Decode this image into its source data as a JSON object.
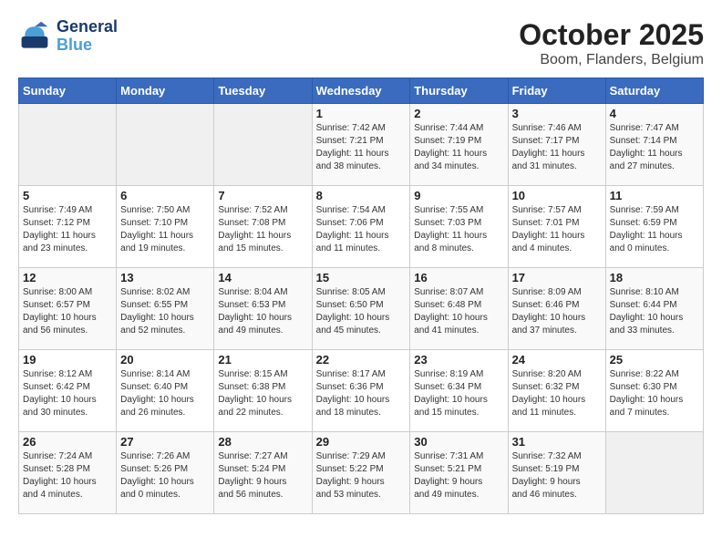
{
  "header": {
    "logo_line1": "General",
    "logo_line2": "Blue",
    "title": "October 2025",
    "subtitle": "Boom, Flanders, Belgium"
  },
  "days_of_week": [
    "Sunday",
    "Monday",
    "Tuesday",
    "Wednesday",
    "Thursday",
    "Friday",
    "Saturday"
  ],
  "weeks": [
    [
      {
        "day": "",
        "info": ""
      },
      {
        "day": "",
        "info": ""
      },
      {
        "day": "",
        "info": ""
      },
      {
        "day": "1",
        "info": "Sunrise: 7:42 AM\nSunset: 7:21 PM\nDaylight: 11 hours\nand 38 minutes."
      },
      {
        "day": "2",
        "info": "Sunrise: 7:44 AM\nSunset: 7:19 PM\nDaylight: 11 hours\nand 34 minutes."
      },
      {
        "day": "3",
        "info": "Sunrise: 7:46 AM\nSunset: 7:17 PM\nDaylight: 11 hours\nand 31 minutes."
      },
      {
        "day": "4",
        "info": "Sunrise: 7:47 AM\nSunset: 7:14 PM\nDaylight: 11 hours\nand 27 minutes."
      }
    ],
    [
      {
        "day": "5",
        "info": "Sunrise: 7:49 AM\nSunset: 7:12 PM\nDaylight: 11 hours\nand 23 minutes."
      },
      {
        "day": "6",
        "info": "Sunrise: 7:50 AM\nSunset: 7:10 PM\nDaylight: 11 hours\nand 19 minutes."
      },
      {
        "day": "7",
        "info": "Sunrise: 7:52 AM\nSunset: 7:08 PM\nDaylight: 11 hours\nand 15 minutes."
      },
      {
        "day": "8",
        "info": "Sunrise: 7:54 AM\nSunset: 7:06 PM\nDaylight: 11 hours\nand 11 minutes."
      },
      {
        "day": "9",
        "info": "Sunrise: 7:55 AM\nSunset: 7:03 PM\nDaylight: 11 hours\nand 8 minutes."
      },
      {
        "day": "10",
        "info": "Sunrise: 7:57 AM\nSunset: 7:01 PM\nDaylight: 11 hours\nand 4 minutes."
      },
      {
        "day": "11",
        "info": "Sunrise: 7:59 AM\nSunset: 6:59 PM\nDaylight: 11 hours\nand 0 minutes."
      }
    ],
    [
      {
        "day": "12",
        "info": "Sunrise: 8:00 AM\nSunset: 6:57 PM\nDaylight: 10 hours\nand 56 minutes."
      },
      {
        "day": "13",
        "info": "Sunrise: 8:02 AM\nSunset: 6:55 PM\nDaylight: 10 hours\nand 52 minutes."
      },
      {
        "day": "14",
        "info": "Sunrise: 8:04 AM\nSunset: 6:53 PM\nDaylight: 10 hours\nand 49 minutes."
      },
      {
        "day": "15",
        "info": "Sunrise: 8:05 AM\nSunset: 6:50 PM\nDaylight: 10 hours\nand 45 minutes."
      },
      {
        "day": "16",
        "info": "Sunrise: 8:07 AM\nSunset: 6:48 PM\nDaylight: 10 hours\nand 41 minutes."
      },
      {
        "day": "17",
        "info": "Sunrise: 8:09 AM\nSunset: 6:46 PM\nDaylight: 10 hours\nand 37 minutes."
      },
      {
        "day": "18",
        "info": "Sunrise: 8:10 AM\nSunset: 6:44 PM\nDaylight: 10 hours\nand 33 minutes."
      }
    ],
    [
      {
        "day": "19",
        "info": "Sunrise: 8:12 AM\nSunset: 6:42 PM\nDaylight: 10 hours\nand 30 minutes."
      },
      {
        "day": "20",
        "info": "Sunrise: 8:14 AM\nSunset: 6:40 PM\nDaylight: 10 hours\nand 26 minutes."
      },
      {
        "day": "21",
        "info": "Sunrise: 8:15 AM\nSunset: 6:38 PM\nDaylight: 10 hours\nand 22 minutes."
      },
      {
        "day": "22",
        "info": "Sunrise: 8:17 AM\nSunset: 6:36 PM\nDaylight: 10 hours\nand 18 minutes."
      },
      {
        "day": "23",
        "info": "Sunrise: 8:19 AM\nSunset: 6:34 PM\nDaylight: 10 hours\nand 15 minutes."
      },
      {
        "day": "24",
        "info": "Sunrise: 8:20 AM\nSunset: 6:32 PM\nDaylight: 10 hours\nand 11 minutes."
      },
      {
        "day": "25",
        "info": "Sunrise: 8:22 AM\nSunset: 6:30 PM\nDaylight: 10 hours\nand 7 minutes."
      }
    ],
    [
      {
        "day": "26",
        "info": "Sunrise: 7:24 AM\nSunset: 5:28 PM\nDaylight: 10 hours\nand 4 minutes."
      },
      {
        "day": "27",
        "info": "Sunrise: 7:26 AM\nSunset: 5:26 PM\nDaylight: 10 hours\nand 0 minutes."
      },
      {
        "day": "28",
        "info": "Sunrise: 7:27 AM\nSunset: 5:24 PM\nDaylight: 9 hours\nand 56 minutes."
      },
      {
        "day": "29",
        "info": "Sunrise: 7:29 AM\nSunset: 5:22 PM\nDaylight: 9 hours\nand 53 minutes."
      },
      {
        "day": "30",
        "info": "Sunrise: 7:31 AM\nSunset: 5:21 PM\nDaylight: 9 hours\nand 49 minutes."
      },
      {
        "day": "31",
        "info": "Sunrise: 7:32 AM\nSunset: 5:19 PM\nDaylight: 9 hours\nand 46 minutes."
      },
      {
        "day": "",
        "info": ""
      }
    ]
  ]
}
